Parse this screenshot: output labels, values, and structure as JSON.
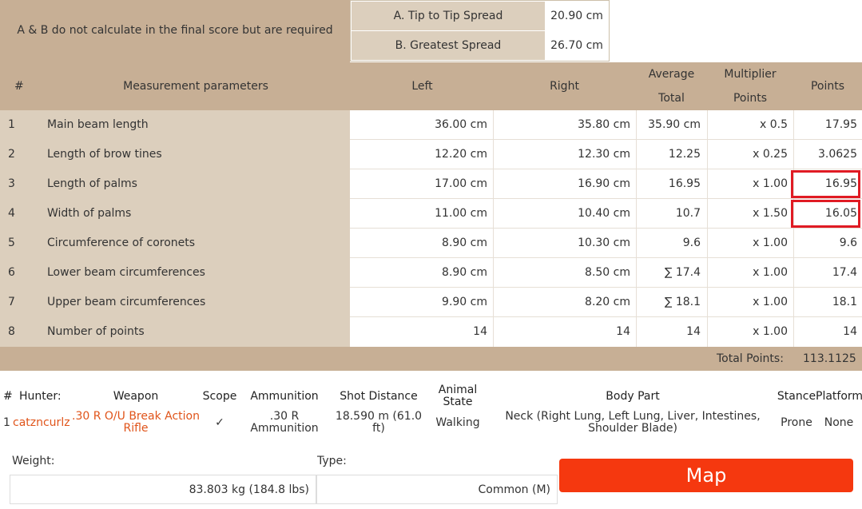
{
  "top": {
    "note": "A & B do not calculate in the final score but are required",
    "spreads": [
      {
        "label": "A. Tip to Tip Spread",
        "value": "20.90 cm"
      },
      {
        "label": "B. Greatest Spread",
        "value": "26.70 cm"
      }
    ]
  },
  "table": {
    "headers": {
      "num": "#",
      "param": "Measurement parameters",
      "left": "Left",
      "right": "Right",
      "avg1": "Average",
      "avg2": "Total",
      "mul1": "Multiplier",
      "mul2": "Points",
      "points": "Points"
    },
    "rows": [
      {
        "num": "1",
        "param": "Main beam length",
        "left": "36.00 cm",
        "right": "35.80 cm",
        "avg": "35.90 cm",
        "mul": "x 0.5",
        "points": "17.95"
      },
      {
        "num": "2",
        "param": "Length of brow tines",
        "left": "12.20 cm",
        "right": "12.30 cm",
        "avg": "12.25",
        "mul": "x 0.25",
        "points": "3.0625"
      },
      {
        "num": "3",
        "param": "Length of palms",
        "left": "17.00 cm",
        "right": "16.90 cm",
        "avg": "16.95",
        "mul": "x 1.00",
        "points": "16.95"
      },
      {
        "num": "4",
        "param": "Width of palms",
        "left": "11.00 cm",
        "right": "10.40 cm",
        "avg": "10.7",
        "mul": "x 1.50",
        "points": "16.05"
      },
      {
        "num": "5",
        "param": "Circumference of coronets",
        "left": "8.90 cm",
        "right": "10.30 cm",
        "avg": "9.6",
        "mul": "x 1.00",
        "points": "9.6"
      },
      {
        "num": "6",
        "param": "Lower beam circumferences",
        "left": "8.90 cm",
        "right": "8.50 cm",
        "avg": "∑ 17.4",
        "mul": "x 1.00",
        "points": "17.4"
      },
      {
        "num": "7",
        "param": "Upper beam circumferences",
        "left": "9.90 cm",
        "right": "8.20 cm",
        "avg": "∑ 18.1",
        "mul": "x 1.00",
        "points": "18.1"
      },
      {
        "num": "8",
        "param": "Number of points",
        "left": "14",
        "right": "14",
        "avg": "14",
        "mul": "x 1.00",
        "points": "14"
      }
    ],
    "total_label": "Total Points:",
    "total_value": "113.1125"
  },
  "hunter": {
    "headers": {
      "num": "#",
      "hunter": "Hunter:",
      "weapon": "Weapon",
      "scope": "Scope",
      "ammo": "Ammunition",
      "distance": "Shot Distance",
      "animal1": "Animal",
      "animal2": "State",
      "body": "Body Part",
      "stance": "Stance",
      "platform": "Platform"
    },
    "row": {
      "num": "1",
      "hunter": "catzncurlz",
      "weapon1": ".30 R O/U Break Action",
      "weapon2": "Rifle",
      "scope": "✓",
      "ammo1": ".30 R",
      "ammo2": "Ammunition",
      "distance1": "18.590 m (61.0",
      "distance2": "ft)",
      "animal": "Walking",
      "body1": "Neck (Right Lung, Left Lung, Liver, Intestines,",
      "body2": "Shoulder Blade)",
      "stance": "Prone",
      "platform": "None"
    }
  },
  "bottom": {
    "weight_label": "Weight:",
    "weight_value": "83.803 kg (184.8 lbs)",
    "type_label": "Type:",
    "type_value": "Common (M)",
    "map_label": "Map"
  },
  "colors": {
    "tan_dark": "#c7af95",
    "tan_light": "#dccfbd",
    "accent_orange": "#f5380f",
    "link_orange": "#e0541a",
    "highlight_red": "#e01b24"
  }
}
